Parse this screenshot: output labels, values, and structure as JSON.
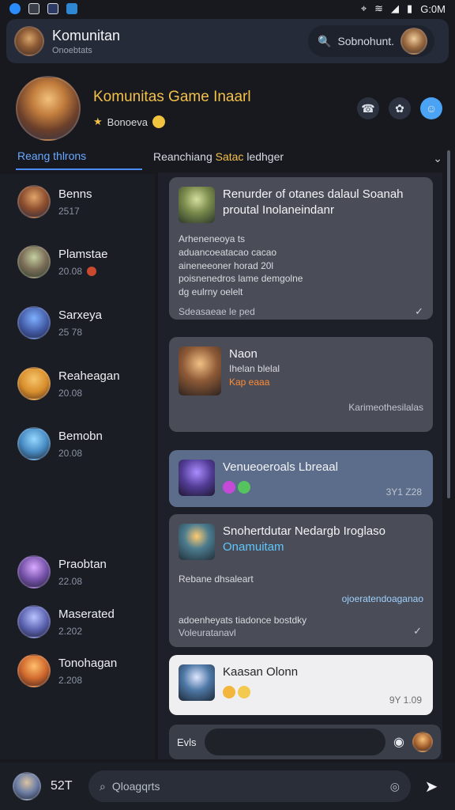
{
  "status": {
    "time": "G:0M",
    "battery": "59"
  },
  "appbar": {
    "title": "Komunitan",
    "subtitle": "Onoebtats",
    "search_text": "Sobnohunt."
  },
  "group": {
    "name": "Komunitas Game Inaarl",
    "meta": "Bonoeva"
  },
  "tabs": {
    "first": "Reang thlrons",
    "second_prefix": "Reanchiang",
    "second_highlight": "Satac",
    "second_suffix": "ledhger"
  },
  "contacts": [
    {
      "name": "Benns",
      "time": "2517"
    },
    {
      "name": "Plamstae",
      "time": "20.08"
    },
    {
      "name": "Sarxeya",
      "time": "25 78"
    },
    {
      "name": "Reaheagan",
      "time": "20.08"
    },
    {
      "name": "Bemobn",
      "time": "20.08"
    },
    {
      "name": "Praobtan",
      "time": "22.08"
    },
    {
      "name": "Maserated",
      "time": "2.202"
    },
    {
      "name": "Tonohagan",
      "time": "2.208"
    }
  ],
  "messages": [
    {
      "title": "Renurder of otanes dalaul Soanah proutal Inolaneindanr",
      "body1": "Arheneneoya ts",
      "body2": "aduancoeatacao cacao",
      "body3": "aineneeoner horad 20l",
      "body4": "poisnenedros lame demgolne",
      "body5": "dg eulrny oelelt",
      "footer": "Sdeasaeae le ped"
    },
    {
      "title": "Naon",
      "body1": "Ihelan blelal",
      "body2": "Kap eaaa",
      "footer": "Karimeothesilalas"
    },
    {
      "title": "Venueoeroals Lbreaal",
      "footer": "3Y1 Z28"
    },
    {
      "title": "Snohertdutar Nedargb Iroglaso",
      "subtitle": "Onamuitam",
      "body1": "Rebane dhsaleart",
      "body2": "ojoeratendoaganao",
      "body3": "adoenheyats tiadonce bostdky",
      "body4": "Voleuratanavl"
    },
    {
      "title": "Kaasan Olonn",
      "footer": "9Y 1.09"
    }
  ],
  "composer": {
    "label": "Evls"
  },
  "bottom": {
    "count": "52T",
    "placeholder": "Qloagqrts"
  },
  "colors": {
    "accent": "#4b8cf3",
    "gold": "#f3c04a",
    "bubble": "#4a4d57",
    "bubble_blue": "#5c6d8b",
    "bubble_light": "#efeff1"
  }
}
